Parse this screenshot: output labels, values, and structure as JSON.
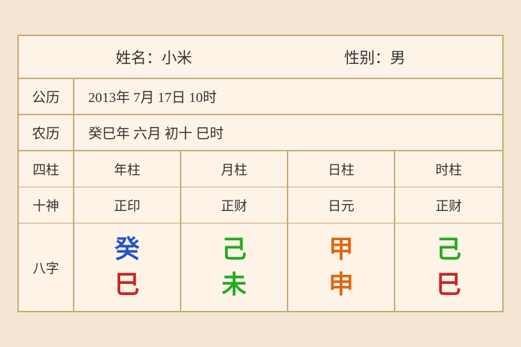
{
  "header": {
    "name_label": "姓名：小米",
    "gender_label": "性别：男"
  },
  "gregorian": {
    "label": "公历",
    "value": "2013年 7月 17日 10时"
  },
  "lunar": {
    "label": "农历",
    "value": "癸巳年 六月 初十 巳时"
  },
  "grid": {
    "row_sizhu": {
      "label": "四柱",
      "cols": [
        "年柱",
        "月柱",
        "日柱",
        "时柱"
      ]
    },
    "row_shishen": {
      "label": "十神",
      "cols": [
        "正印",
        "正财",
        "日元",
        "正财"
      ]
    }
  },
  "bazi": {
    "label": "八字",
    "columns": [
      {
        "top_char": "癸",
        "top_color": "blue",
        "bottom_char": "巳",
        "bottom_color": "red"
      },
      {
        "top_char": "己",
        "top_color": "green",
        "bottom_char": "未",
        "bottom_color": "darkgreen"
      },
      {
        "top_char": "甲",
        "top_color": "orange",
        "bottom_char": "申",
        "bottom_color": "orange"
      },
      {
        "top_char": "己",
        "top_color": "green2",
        "bottom_char": "巳",
        "bottom_color": "red2"
      }
    ]
  },
  "colors": {
    "blue": "#2255cc",
    "green": "#22aa22",
    "orange": "#dd6611",
    "red": "#cc2222",
    "darkgreen": "#22aa22"
  }
}
